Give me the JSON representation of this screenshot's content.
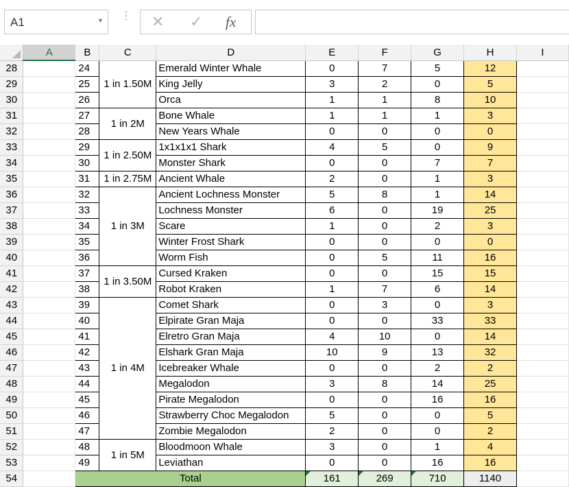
{
  "formula_bar": {
    "name_box": "A1",
    "name_box_caret": "▾",
    "dots": "⋮",
    "cancel_glyph": "✕",
    "enter_glyph": "✓",
    "fx_label": "fx",
    "formula": ""
  },
  "columns": [
    "A",
    "B",
    "C",
    "D",
    "E",
    "F",
    "G",
    "H",
    "I"
  ],
  "selected_column": "A",
  "rows": [
    {
      "row": "28",
      "b": "24",
      "d": "Emerald Winter Whale",
      "e": "0",
      "f": "7",
      "g": "5",
      "h": "12"
    },
    {
      "row": "29",
      "b": "25",
      "d": "King Jelly",
      "e": "3",
      "f": "2",
      "g": "0",
      "h": "5"
    },
    {
      "row": "30",
      "b": "26",
      "d": "Orca",
      "e": "1",
      "f": "1",
      "g": "8",
      "h": "10"
    },
    {
      "row": "31",
      "b": "27",
      "d": "Bone Whale",
      "e": "1",
      "f": "1",
      "g": "1",
      "h": "3"
    },
    {
      "row": "32",
      "b": "28",
      "d": "New Years Whale",
      "e": "0",
      "f": "0",
      "g": "0",
      "h": "0"
    },
    {
      "row": "33",
      "b": "29",
      "d": "1x1x1x1 Shark",
      "e": "4",
      "f": "5",
      "g": "0",
      "h": "9"
    },
    {
      "row": "34",
      "b": "30",
      "d": "Monster Shark",
      "e": "0",
      "f": "0",
      "g": "7",
      "h": "7"
    },
    {
      "row": "35",
      "b": "31",
      "d": "Ancient Whale",
      "e": "2",
      "f": "0",
      "g": "1",
      "h": "3"
    },
    {
      "row": "36",
      "b": "32",
      "d": "Ancient Lochness Monster",
      "e": "5",
      "f": "8",
      "g": "1",
      "h": "14"
    },
    {
      "row": "37",
      "b": "33",
      "d": "Lochness Monster",
      "e": "6",
      "f": "0",
      "g": "19",
      "h": "25"
    },
    {
      "row": "38",
      "b": "34",
      "d": "Scare",
      "e": "1",
      "f": "0",
      "g": "2",
      "h": "3"
    },
    {
      "row": "39",
      "b": "35",
      "d": "Winter Frost Shark",
      "e": "0",
      "f": "0",
      "g": "0",
      "h": "0"
    },
    {
      "row": "40",
      "b": "36",
      "d": "Worm Fish",
      "e": "0",
      "f": "5",
      "g": "11",
      "h": "16"
    },
    {
      "row": "41",
      "b": "37",
      "d": "Cursed Kraken",
      "e": "0",
      "f": "0",
      "g": "15",
      "h": "15"
    },
    {
      "row": "42",
      "b": "38",
      "d": "Robot Kraken",
      "e": "1",
      "f": "7",
      "g": "6",
      "h": "14"
    },
    {
      "row": "43",
      "b": "39",
      "d": "Comet Shark",
      "e": "0",
      "f": "3",
      "g": "0",
      "h": "3"
    },
    {
      "row": "44",
      "b": "40",
      "d": "Elpirate Gran Maja",
      "e": "0",
      "f": "0",
      "g": "33",
      "h": "33"
    },
    {
      "row": "45",
      "b": "41",
      "d": "Elretro Gran Maja",
      "e": "4",
      "f": "10",
      "g": "0",
      "h": "14"
    },
    {
      "row": "46",
      "b": "42",
      "d": "Elshark Gran Maja",
      "e": "10",
      "f": "9",
      "g": "13",
      "h": "32"
    },
    {
      "row": "47",
      "b": "43",
      "d": "Icebreaker Whale",
      "e": "0",
      "f": "0",
      "g": "2",
      "h": "2"
    },
    {
      "row": "48",
      "b": "44",
      "d": "Megalodon",
      "e": "3",
      "f": "8",
      "g": "14",
      "h": "25"
    },
    {
      "row": "49",
      "b": "45",
      "d": "Pirate Megalodon",
      "e": "0",
      "f": "0",
      "g": "16",
      "h": "16"
    },
    {
      "row": "50",
      "b": "46",
      "d": "Strawberry Choc Megalodon",
      "e": "5",
      "f": "0",
      "g": "0",
      "h": "5"
    },
    {
      "row": "51",
      "b": "47",
      "d": "Zombie Megalodon",
      "e": "2",
      "f": "0",
      "g": "0",
      "h": "2"
    },
    {
      "row": "52",
      "b": "48",
      "d": "Bloodmoon Whale",
      "e": "3",
      "f": "0",
      "g": "1",
      "h": "4"
    },
    {
      "row": "53",
      "b": "49",
      "d": "Leviathan",
      "e": "0",
      "f": "0",
      "g": "16",
      "h": "16"
    }
  ],
  "groups": [
    {
      "label": "1 in 1.50M",
      "start": 0,
      "span": 3
    },
    {
      "label": "1 in 2M",
      "start": 3,
      "span": 2
    },
    {
      "label": "1 in 2.50M",
      "start": 5,
      "span": 2
    },
    {
      "label": "1 in 2.75M",
      "start": 7,
      "span": 1
    },
    {
      "label": "1 in 3M",
      "start": 8,
      "span": 5
    },
    {
      "label": "1 in 3.50M",
      "start": 13,
      "span": 2
    },
    {
      "label": "1 in 4M",
      "start": 15,
      "span": 9
    },
    {
      "label": "1 in 5M",
      "start": 24,
      "span": 2
    }
  ],
  "total_row": {
    "row": "54",
    "label": "Total",
    "e": "161",
    "f": "269",
    "g": "710",
    "h": "1140"
  },
  "colors": {
    "highlight_column": "#ffe699",
    "total_label_fill": "#a9d08e",
    "total_value_fill": "#e2efda",
    "grand_total_fill": "#ededed",
    "excel_green": "#217346"
  }
}
